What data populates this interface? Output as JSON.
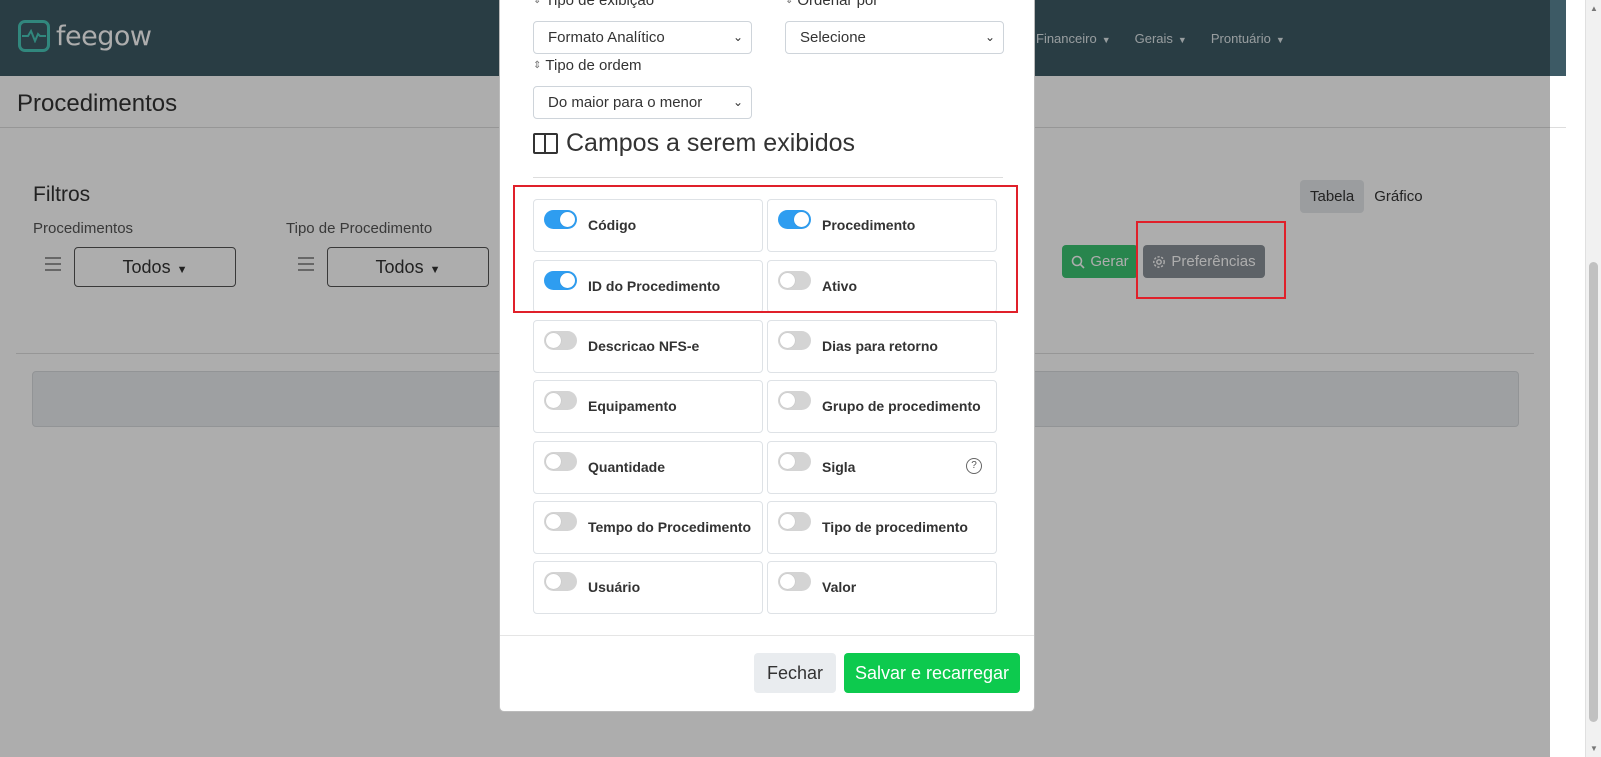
{
  "app": {
    "logo_text": "feegow"
  },
  "nav": {
    "items": [
      "Financeiro",
      "Gerais",
      "Prontuário"
    ]
  },
  "page": {
    "title": "Procedimentos"
  },
  "filters": {
    "title": "Filtros",
    "procedimentos_label": "Procedimentos",
    "tipo_label": "Tipo de Procedimento",
    "procedimentos_value": "Todos",
    "tipo_value": "Todos"
  },
  "view_tabs": {
    "tabela": "Tabela",
    "grafico": "Gráfico"
  },
  "actions": {
    "gerar": "Gerar",
    "preferencias": "Preferências"
  },
  "modal": {
    "tipo_exibicao_label": "Tipo de exibição",
    "tipo_exibicao_value": "Formato Analítico",
    "ordenar_por_label": "Ordenar por",
    "ordenar_por_value": "Selecione",
    "tipo_ordem_label": "Tipo de ordem",
    "tipo_ordem_value": "Do maior para o menor",
    "section_title": "Campos a serem exibidos",
    "fields": [
      {
        "label": "Código",
        "enabled": true
      },
      {
        "label": "Procedimento",
        "enabled": true
      },
      {
        "label": "ID do Procedimento",
        "enabled": true
      },
      {
        "label": "Ativo",
        "enabled": false
      },
      {
        "label": "Descricao NFS-e",
        "enabled": false
      },
      {
        "label": "Dias para retorno",
        "enabled": false
      },
      {
        "label": "Equipamento",
        "enabled": false
      },
      {
        "label": "Grupo de procedimento",
        "enabled": false
      },
      {
        "label": "Quantidade",
        "enabled": false
      },
      {
        "label": "Sigla",
        "enabled": false
      },
      {
        "label": "Tempo do Procedimento",
        "enabled": false
      },
      {
        "label": "Tipo de procedimento",
        "enabled": false
      },
      {
        "label": "Usuário",
        "enabled": false
      },
      {
        "label": "Valor",
        "enabled": false
      }
    ],
    "fechar": "Fechar",
    "salvar": "Salvar e recarregar"
  }
}
